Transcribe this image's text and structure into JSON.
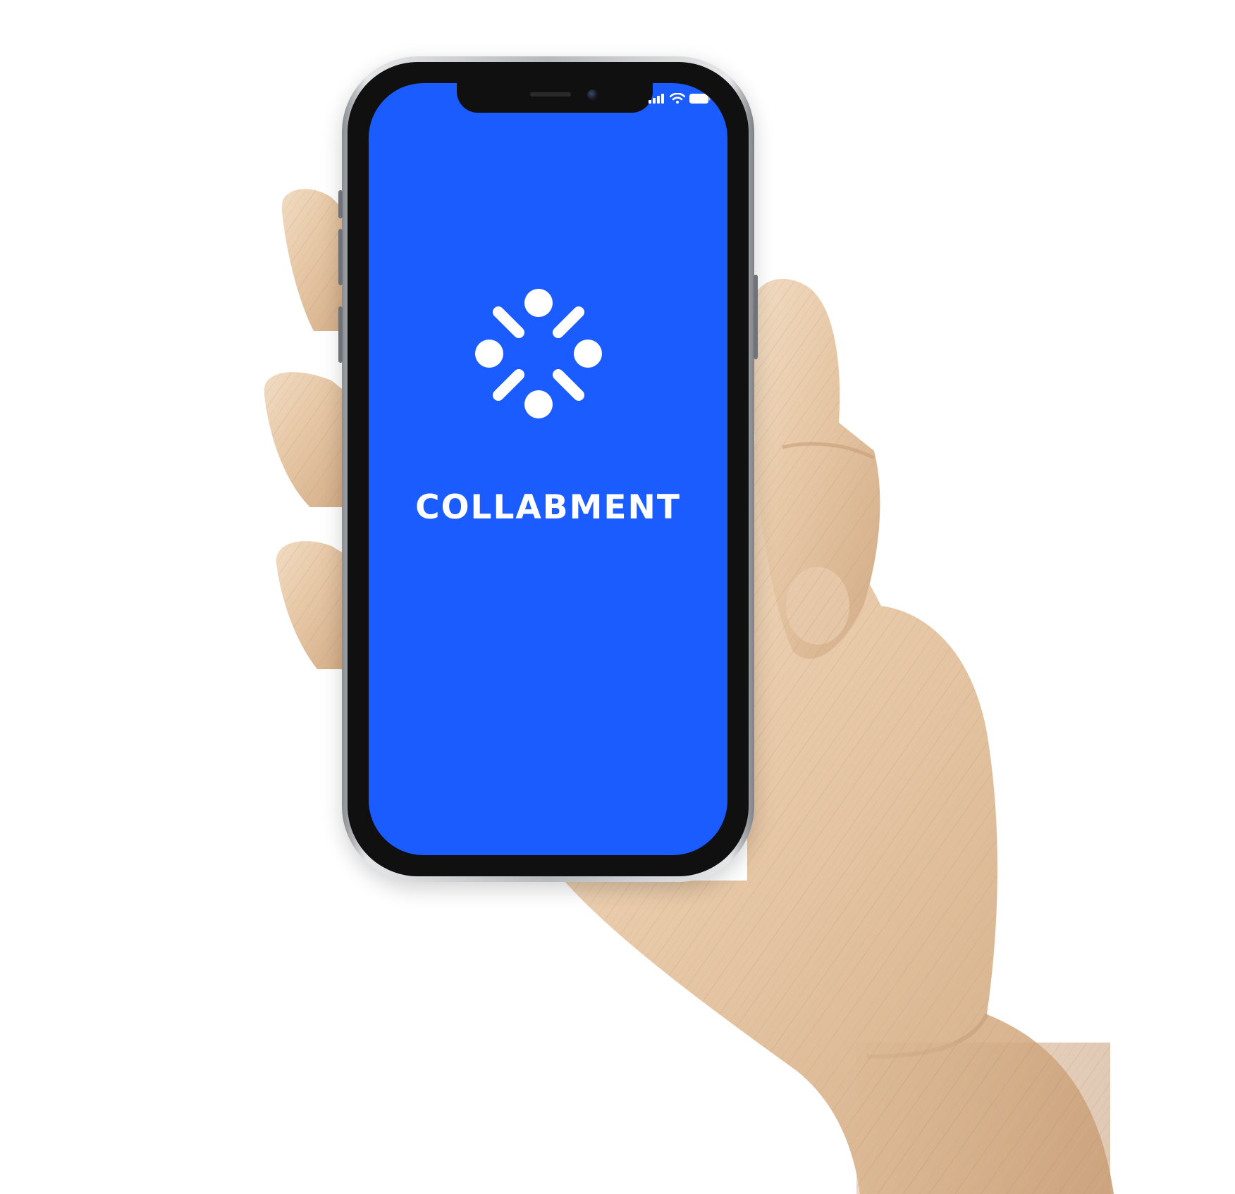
{
  "screen": {
    "background_color": "#1a5cff",
    "logo_icon": "collabment-logo-icon",
    "logo_color": "#ffffff",
    "app_name": "COLLABMENT"
  },
  "status_bar": {
    "icons": [
      "cellular-signal-icon",
      "wifi-icon",
      "battery-icon"
    ]
  },
  "hand": {
    "description_icon": "wooden-mannequin-hand"
  }
}
